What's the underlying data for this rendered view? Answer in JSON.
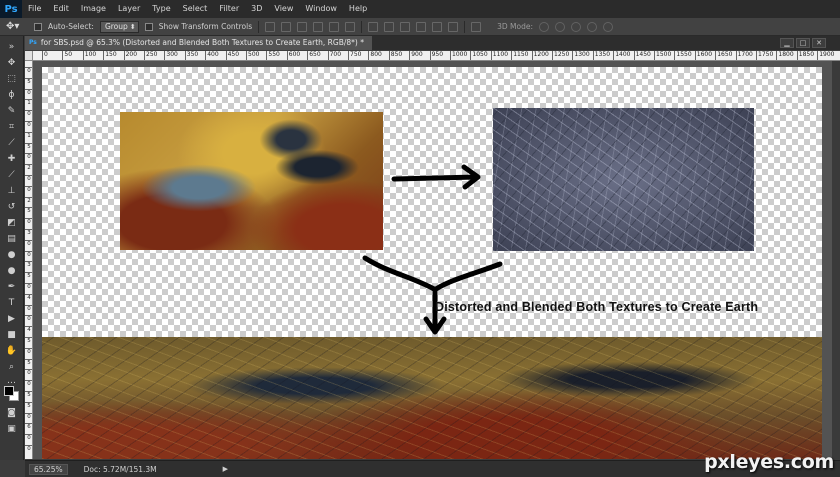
{
  "app": {
    "logo": "Ps",
    "menu": [
      "File",
      "Edit",
      "Image",
      "Layer",
      "Type",
      "Select",
      "Filter",
      "3D",
      "View",
      "Window",
      "Help"
    ]
  },
  "options": {
    "auto_select_label": "Auto-Select:",
    "auto_select_value": "Group",
    "show_transform_label": "Show Transform Controls",
    "mode3d_label": "3D Mode:"
  },
  "document": {
    "tab_title": "for SBS.psd @ 65.3% (Distorted and Blended Both Textures to Create Earth, RGB/8*) *",
    "min_label": "▁",
    "max_label": "□",
    "close_label": "✕"
  },
  "rulers": {
    "horizontal": [
      "0",
      "50",
      "100",
      "150",
      "200",
      "250",
      "300",
      "350",
      "400",
      "450",
      "500",
      "550",
      "600",
      "650",
      "700",
      "750",
      "800",
      "850",
      "900",
      "950",
      "1000",
      "1050",
      "1100",
      "1150",
      "1200",
      "1250",
      "1300",
      "1350",
      "1400",
      "1450",
      "1500",
      "1550",
      "1600",
      "1650",
      "1700",
      "1750",
      "1800",
      "1850",
      "1900"
    ],
    "vertical": [
      "0",
      "5",
      "0",
      "1",
      "0",
      "0",
      "1",
      "5",
      "0",
      "2",
      "0",
      "0",
      "2",
      "5",
      "0",
      "3",
      "0",
      "0",
      "3",
      "5",
      "0",
      "4",
      "0",
      "0",
      "4",
      "5",
      "0",
      "5",
      "0",
      "0",
      "5",
      "5",
      "0",
      "6",
      "0",
      "0"
    ]
  },
  "canvas": {
    "caption": "Distorted and Blended Both Textures to Create Earth"
  },
  "status": {
    "zoom": "65.25%",
    "doc_info": "Doc: 5.72M/151.3M",
    "arrow": "▶"
  },
  "watermark": "pxleyes.com"
}
